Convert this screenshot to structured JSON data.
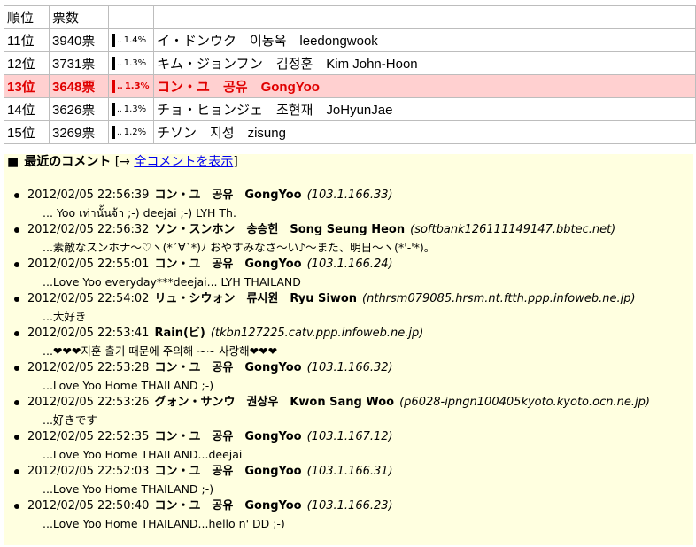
{
  "ranking": {
    "header": {
      "rank": "順位",
      "votes": "票数"
    },
    "rows": [
      {
        "rank": "11位",
        "votes": "3940票",
        "pct": "1.4%",
        "name": "イ・ドンウク　이동욱　leedongwook"
      },
      {
        "rank": "12位",
        "votes": "3731票",
        "pct": "1.3%",
        "name": "キム・ジョンフン　김정훈　Kim John-Hoon"
      },
      {
        "rank": "13位",
        "votes": "3648票",
        "pct": "1.3%",
        "name": "コン・ユ　공유　GongYoo",
        "highlight": true
      },
      {
        "rank": "14位",
        "votes": "3626票",
        "pct": "1.3%",
        "name": "チョ・ヒョンジェ　조현재　JoHyunJae"
      },
      {
        "rank": "15位",
        "votes": "3269票",
        "pct": "1.2%",
        "name": "チソン　지성　zisung"
      }
    ]
  },
  "comments_section": {
    "bullet": "■",
    "title": "最近のコメント",
    "prefix": "[→",
    "link_label": "全コメントを表示",
    "suffix": "]",
    "items": [
      {
        "time": "2012/02/05 22:56:39",
        "name": "コン・ユ　공유　GongYoo",
        "host": "(103.1.166.33)",
        "text": "... Yoo เท่านั้นจ้า ;-) deejai ;-) LYH Th."
      },
      {
        "time": "2012/02/05 22:56:32",
        "name": "ソン・スンホン　송승헌　Song Seung Heon",
        "host": "(softbank126111149147.bbtec.net)",
        "text": "...素敵なスンホナ〜♡ヽ(*´∀`*)ﾉ おやすみなさ〜い♪〜また、明日〜ヽ(*'-'*)。"
      },
      {
        "time": "2012/02/05 22:55:01",
        "name": "コン・ユ　공유　GongYoo",
        "host": "(103.1.166.24)",
        "text": "...Love Yoo everyday***deejai... LYH THAILAND"
      },
      {
        "time": "2012/02/05 22:54:02",
        "name": "リュ・シウォン　류시원　Ryu Siwon",
        "host": "(nthrsm079085.hrsm.nt.ftth.ppp.infoweb.ne.jp)",
        "text": "...大好き"
      },
      {
        "time": "2012/02/05 22:53:41",
        "name": "Rain(ビ)",
        "host": "(tkbn127225.catv.ppp.infoweb.ne.jp)",
        "text": "...❤❤❤지훈 출기 때문에 주의해 ~~ 사랑해❤❤❤"
      },
      {
        "time": "2012/02/05 22:53:28",
        "name": "コン・ユ　공유　GongYoo",
        "host": "(103.1.166.32)",
        "text": "...Love Yoo Home THAILAND ;-)"
      },
      {
        "time": "2012/02/05 22:53:26",
        "name": "グォン・サンウ　권상우　Kwon Sang Woo",
        "host": "(p6028-ipngn100405kyoto.kyoto.ocn.ne.jp)",
        "text": "...好きです"
      },
      {
        "time": "2012/02/05 22:52:35",
        "name": "コン・ユ　공유　GongYoo",
        "host": "(103.1.167.12)",
        "text": "...Love Yoo Home THAILAND...deejai"
      },
      {
        "time": "2012/02/05 22:52:03",
        "name": "コン・ユ　공유　GongYoo",
        "host": "(103.1.166.31)",
        "text": "...Love Yoo Home THAILAND ;-)"
      },
      {
        "time": "2012/02/05 22:50:40",
        "name": "コン・ユ　공유　GongYoo",
        "host": "(103.1.166.23)",
        "text": "...Love Yoo Home THAILAND...hello n' DD ;-)"
      }
    ]
  }
}
